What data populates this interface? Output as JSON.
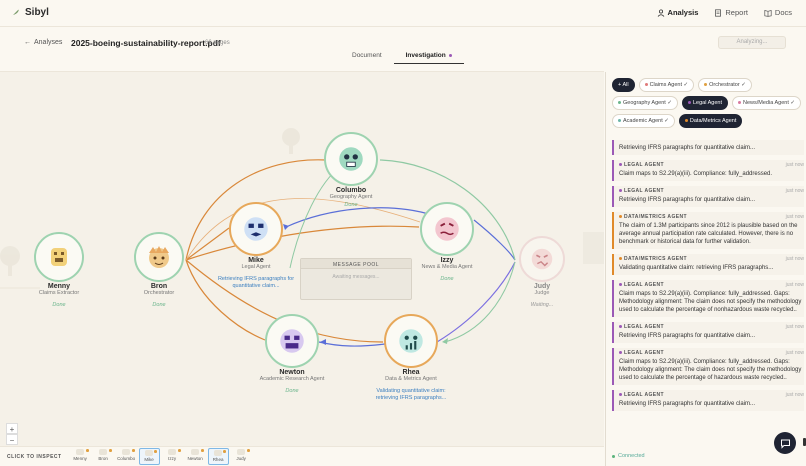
{
  "app": {
    "brand": "Sibyl"
  },
  "nav": {
    "analysis": "Analysis",
    "report": "Report",
    "docs": "Docs"
  },
  "subheader": {
    "back": "Analyses",
    "filename": "2025-boeing-sustainability-report.pdf",
    "pages": "66 pages",
    "status_button": "Analyzing..."
  },
  "tabs": {
    "document": "Document",
    "investigation": "Investigation"
  },
  "agents": [
    {
      "name": "Menny",
      "role": "Claims Extractor",
      "status": "Done"
    },
    {
      "name": "Bron",
      "role": "Orchestrator",
      "status": "Done"
    },
    {
      "name": "Columbo",
      "role": "Geography Agent",
      "status": "Done"
    },
    {
      "name": "Mike",
      "role": "Legal Agent",
      "task": "Retrieving IFRS paragraphs for quantitative claim..."
    },
    {
      "name": "Izzy",
      "role": "News & Media Agent",
      "status": "Done"
    },
    {
      "name": "Newton",
      "role": "Academic Research Agent",
      "status": "Done"
    },
    {
      "name": "Rhea",
      "role": "Data & Metrics Agent",
      "task": "Validating quantitative claim: retrieving IFRS paragraphs..."
    },
    {
      "name": "Judy",
      "role": "Judge",
      "status": "Waiting..."
    }
  ],
  "message_pool": {
    "title": "MESSAGE POOL",
    "body": "Awaiting messages..."
  },
  "zoom": {
    "in": "+",
    "out": "−"
  },
  "inspect": {
    "label": "CLICK TO INSPECT",
    "chips": [
      "Menny",
      "Bron",
      "Columbo",
      "Mike",
      "Izzy",
      "Newton",
      "Rhea",
      "Judy"
    ]
  },
  "filters": [
    {
      "label": "All",
      "dark": true
    },
    {
      "label": "Claims Agent",
      "dark": false,
      "check": "✓"
    },
    {
      "label": "Orchestrator",
      "dark": false,
      "check": "✓"
    },
    {
      "label": "Geography Agent",
      "dark": false,
      "check": "✓"
    },
    {
      "label": "Legal Agent",
      "dark": true
    },
    {
      "label": "News/Media Agent",
      "dark": false,
      "check": "✓"
    },
    {
      "label": "Academic Agent",
      "dark": false,
      "check": "✓"
    },
    {
      "label": "Data/Metrics Agent",
      "dark": true
    }
  ],
  "feed": [
    {
      "agent": "",
      "time": "",
      "text": "Retrieving IFRS paragraphs for quantitative claim..."
    },
    {
      "agent": "LEGAL AGENT",
      "time": "just now",
      "text": "Claim maps to S2.29(a)(iii). Compliance: fully_addressed."
    },
    {
      "agent": "LEGAL AGENT",
      "time": "just now",
      "text": "Retrieving IFRS paragraphs for quantitative claim..."
    },
    {
      "agent": "DATA/METRICS AGENT",
      "time": "just now",
      "text": "The claim of 1.3M participants since 2012 is plausible based on the average annual participation rate calculated. However, there is no benchmark or historical data for further validation."
    },
    {
      "agent": "DATA/METRICS AGENT",
      "time": "just now",
      "text": "Validating quantitative claim: retrieving IFRS paragraphs..."
    },
    {
      "agent": "LEGAL AGENT",
      "time": "just now",
      "text": "Claim maps to S2.29(a)(iii). Compliance: fully_addressed. Gaps: Methodology alignment: The claim does not specify the methodology used to calculate the percentage of nonhazardous waste recycled.."
    },
    {
      "agent": "LEGAL AGENT",
      "time": "just now",
      "text": "Retrieving IFRS paragraphs for quantitative claim..."
    },
    {
      "agent": "LEGAL AGENT",
      "time": "just now",
      "text": "Claim maps to S2.29(a)(iii). Compliance: fully_addressed. Gaps: Methodology alignment: The claim does not specify the methodology used to calculate the percentage of hazardous waste recycled.."
    },
    {
      "agent": "LEGAL AGENT",
      "time": "just now",
      "text": "Retrieving IFRS paragraphs for quantitative claim..."
    }
  ],
  "connection": "Connected",
  "colors": {
    "legal": "#9b59b6",
    "data": "#e08a2a",
    "done": "#6bb58c",
    "link_orange": "#d9883a",
    "link_blue": "#5b6fd8",
    "link_green": "#8fc9a3"
  }
}
